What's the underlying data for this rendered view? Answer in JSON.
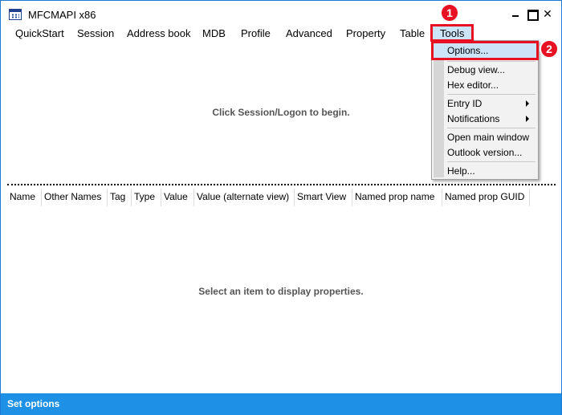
{
  "window": {
    "title": "MFCMAPI x86",
    "close_glyph": "✕"
  },
  "menubar": {
    "items": [
      "QuickStart",
      "Session",
      "Address book",
      "MDB",
      "Profile",
      "Advanced",
      "Property",
      "Table",
      "Tools"
    ]
  },
  "tools_menu": {
    "items": [
      "Options...",
      "Debug view...",
      "Hex editor...",
      "Entry ID",
      "Notifications",
      "Open main window",
      "Outlook version...",
      "Help..."
    ]
  },
  "top_pane": {
    "message": "Click Session/Logon to begin."
  },
  "property_list": {
    "columns": [
      "Name",
      "Other Names",
      "Tag",
      "Type",
      "Value",
      "Value (alternate view)",
      "Smart View",
      "Named prop name",
      "Named prop GUID"
    ],
    "message": "Select an item to display properties."
  },
  "statusbar": {
    "text": "Set options"
  },
  "annotations": {
    "badge_1": "1",
    "badge_2": "2",
    "color": "#e81123"
  },
  "colors": {
    "accent": "#1e90e6",
    "highlight": "#cce4f7"
  }
}
